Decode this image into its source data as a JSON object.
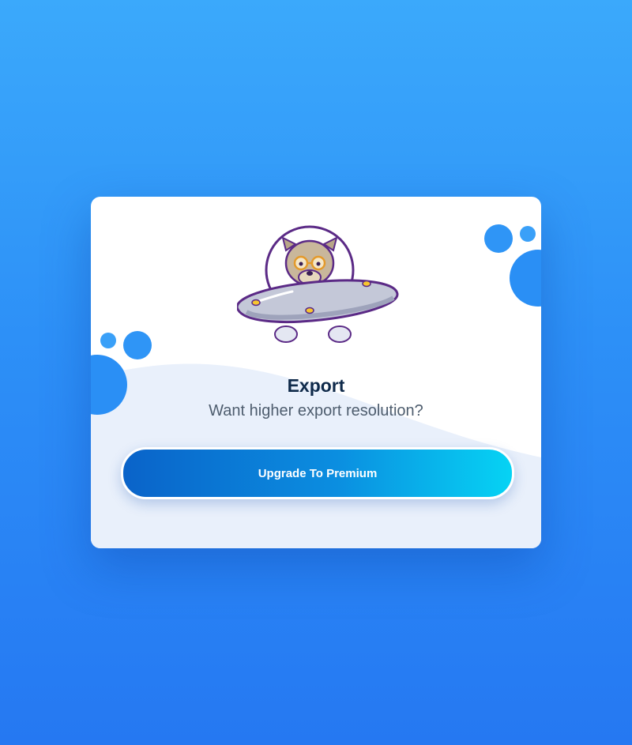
{
  "dialog": {
    "title": "Export",
    "subtitle": "Want higher export resolution?",
    "cta_label": "Upgrade To Premium",
    "illustration": "bulldog-astronaut-ufo-icon"
  },
  "colors": {
    "background_top": "#3ba9fb",
    "background_bottom": "#2578f2",
    "card": "#ffffff",
    "wave": "#e9f0fb",
    "bubble": "#2a8ff5",
    "title": "#0f2a4a",
    "subtitle": "#4e5d6e",
    "button_gradient_start": "#0a63c9",
    "button_gradient_end": "#06d3f4"
  }
}
